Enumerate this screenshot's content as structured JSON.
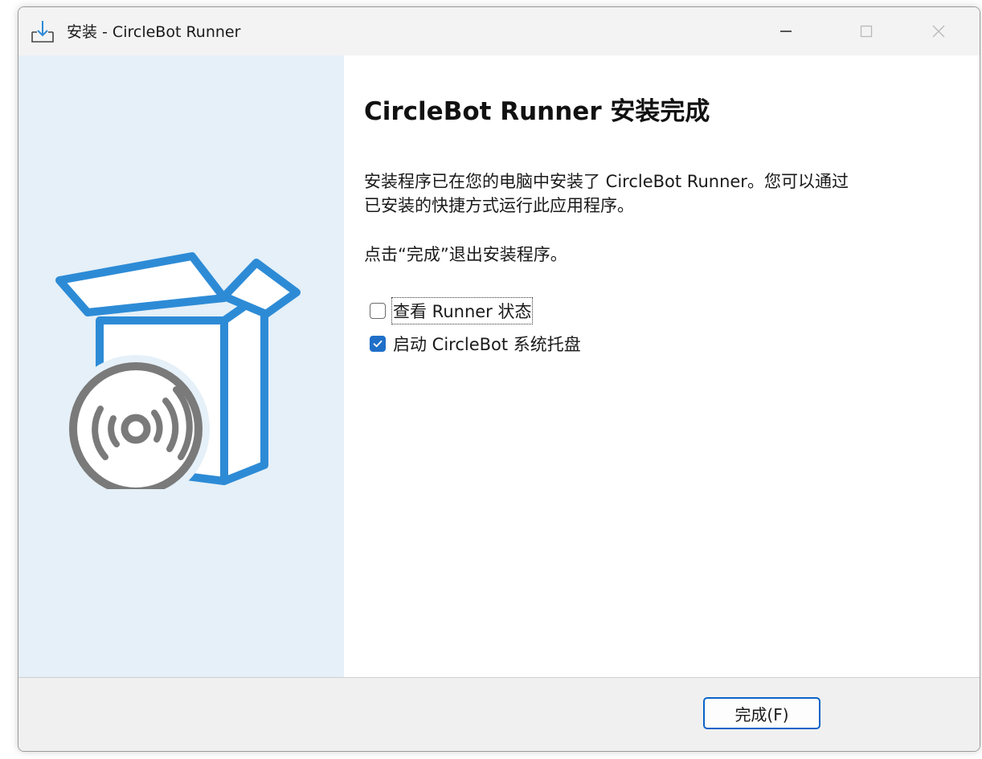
{
  "window": {
    "title": "安装 - CircleBot Runner"
  },
  "content": {
    "heading": "CircleBot Runner 安装完成",
    "description_line1": "安装程序已在您的电脑中安装了 CircleBot Runner。您可以通过",
    "description_line2": "已安装的快捷方式运行此应用程序。",
    "hint": "点击“完成”退出安装程序。"
  },
  "options": [
    {
      "label": "查看 Runner 状态",
      "checked": false
    },
    {
      "label": "启动 CircleBot 系统托盘",
      "checked": true
    }
  ],
  "footer": {
    "finish_label": "完成(F)"
  },
  "colors": {
    "side_panel": "#e5f0f8",
    "accent": "#2d8bd6",
    "checkbox_checked": "#1f6fc8",
    "disc": "#7a7a7a"
  },
  "icons": {
    "title": "download-install-icon",
    "minimize": "minimize-icon",
    "maximize": "maximize-icon",
    "close": "close-icon",
    "banner": "box-with-disc-icon"
  }
}
